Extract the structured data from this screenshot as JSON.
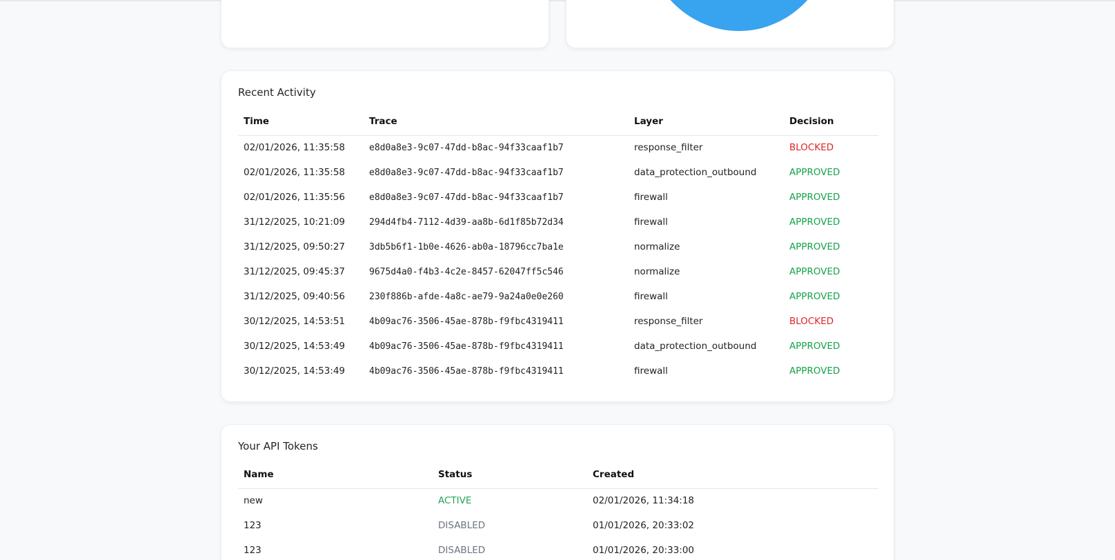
{
  "colors": {
    "accent_pie": "#38a3ee",
    "blocked": "#dc2626",
    "approved": "#16a34a",
    "active": "#22a35a",
    "disabled": "#6b7280"
  },
  "recent_activity": {
    "title": "Recent Activity",
    "columns": [
      "Time",
      "Trace",
      "Layer",
      "Decision"
    ],
    "rows": [
      {
        "time": "02/01/2026, 11:35:58",
        "trace": "e8d0a8e3-9c07-47dd-b8ac-94f33caaf1b7",
        "layer": "response_filter",
        "decision": "BLOCKED"
      },
      {
        "time": "02/01/2026, 11:35:58",
        "trace": "e8d0a8e3-9c07-47dd-b8ac-94f33caaf1b7",
        "layer": "data_protection_outbound",
        "decision": "APPROVED"
      },
      {
        "time": "02/01/2026, 11:35:56",
        "trace": "e8d0a8e3-9c07-47dd-b8ac-94f33caaf1b7",
        "layer": "firewall",
        "decision": "APPROVED"
      },
      {
        "time": "31/12/2025, 10:21:09",
        "trace": "294d4fb4-7112-4d39-aa8b-6d1f85b72d34",
        "layer": "firewall",
        "decision": "APPROVED"
      },
      {
        "time": "31/12/2025, 09:50:27",
        "trace": "3db5b6f1-1b0e-4626-ab0a-18796cc7ba1e",
        "layer": "normalize",
        "decision": "APPROVED"
      },
      {
        "time": "31/12/2025, 09:45:37",
        "trace": "9675d4a0-f4b3-4c2e-8457-62047ff5c546",
        "layer": "normalize",
        "decision": "APPROVED"
      },
      {
        "time": "31/12/2025, 09:40:56",
        "trace": "230f886b-afde-4a8c-ae79-9a24a0e0e260",
        "layer": "firewall",
        "decision": "APPROVED"
      },
      {
        "time": "30/12/2025, 14:53:51",
        "trace": "4b09ac76-3506-45ae-878b-f9fbc4319411",
        "layer": "response_filter",
        "decision": "BLOCKED"
      },
      {
        "time": "30/12/2025, 14:53:49",
        "trace": "4b09ac76-3506-45ae-878b-f9fbc4319411",
        "layer": "data_protection_outbound",
        "decision": "APPROVED"
      },
      {
        "time": "30/12/2025, 14:53:49",
        "trace": "4b09ac76-3506-45ae-878b-f9fbc4319411",
        "layer": "firewall",
        "decision": "APPROVED"
      }
    ]
  },
  "api_tokens": {
    "title": "Your API Tokens",
    "columns": [
      "Name",
      "Status",
      "Created"
    ],
    "rows": [
      {
        "name": "new",
        "status": "ACTIVE",
        "created": "02/01/2026, 11:34:18"
      },
      {
        "name": "123",
        "status": "DISABLED",
        "created": "01/01/2026, 20:33:02"
      },
      {
        "name": "123",
        "status": "DISABLED",
        "created": "01/01/2026, 20:33:00"
      }
    ]
  }
}
